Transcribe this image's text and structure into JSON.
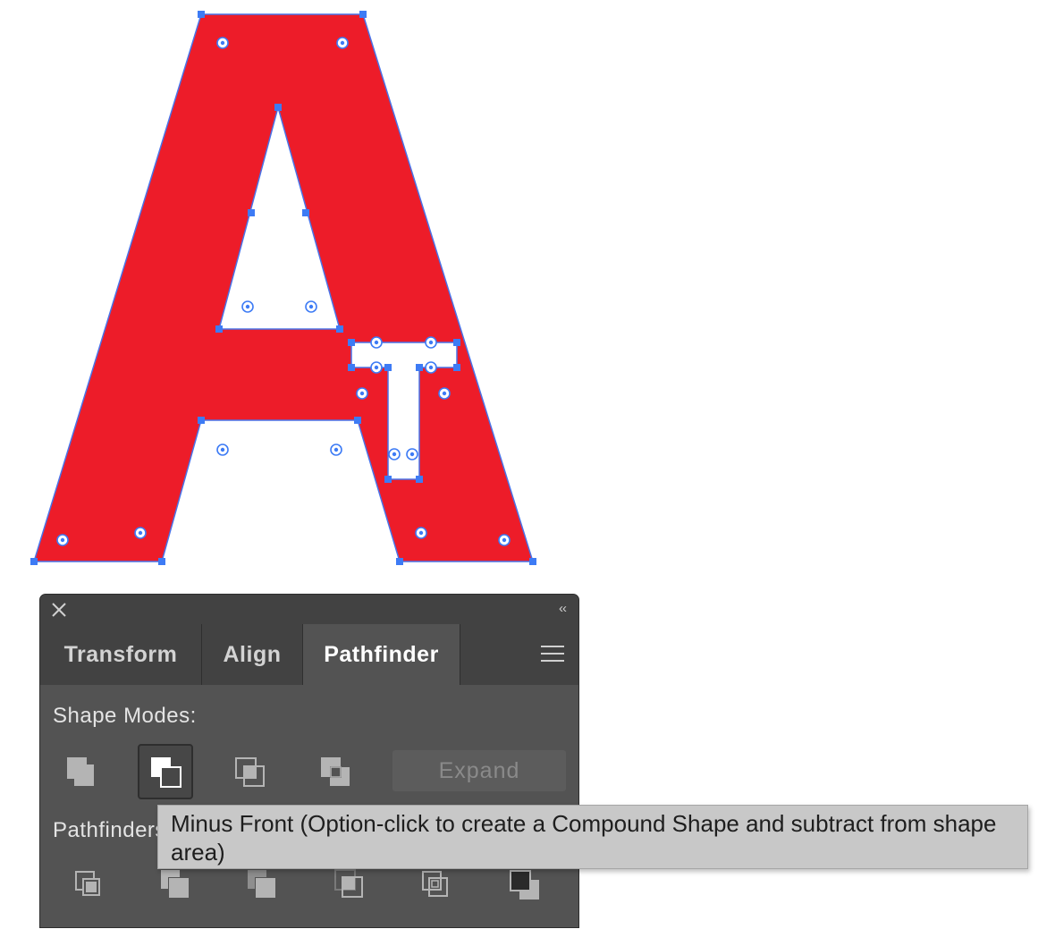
{
  "artwork": {
    "fill_color": "#ed1c29",
    "stroke_color": "#4a73e8",
    "anchor_color": "#3d7bf5"
  },
  "panel": {
    "close_icon": "close-icon",
    "collapse_label": "‹‹",
    "tabs": [
      {
        "label": "Transform",
        "active": false
      },
      {
        "label": "Align",
        "active": false
      },
      {
        "label": "Pathfinder",
        "active": true
      }
    ],
    "menu_icon": "hamburger-menu-icon",
    "shape_modes_label": "Shape Modes:",
    "shape_modes": [
      {
        "name": "unite-icon"
      },
      {
        "name": "minus-front-icon",
        "hovered": true
      },
      {
        "name": "intersect-icon"
      },
      {
        "name": "exclude-icon"
      }
    ],
    "expand_label": "Expand",
    "pathfinders_label": "Pathfinders:",
    "pathfinders": [
      {
        "name": "divide-icon"
      },
      {
        "name": "trim-icon"
      },
      {
        "name": "merge-icon"
      },
      {
        "name": "crop-icon"
      },
      {
        "name": "outline-icon"
      },
      {
        "name": "minus-back-icon"
      }
    ]
  },
  "tooltip": {
    "text": "Minus Front (Option-click to create a Compound Shape and subtract from shape area)"
  }
}
